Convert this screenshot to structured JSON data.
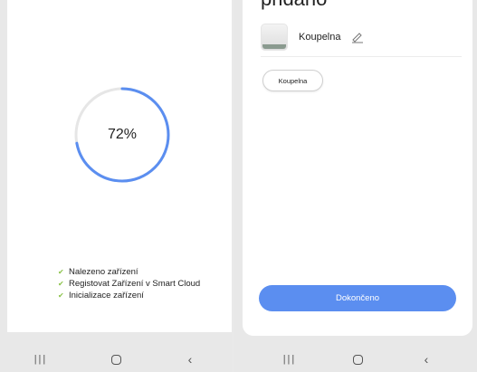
{
  "left": {
    "progress": {
      "value": 0.72,
      "label": "72%"
    },
    "checklist": [
      "Nalezeno zařízení",
      "Registovat Zařízení v Smart Cloud",
      "Inicializace zařízení"
    ],
    "colors": {
      "progress": "#5b8ef0",
      "track": "#e6e6e6",
      "check": "#8bc34a"
    }
  },
  "right": {
    "title": "přidáno",
    "device": {
      "name": "Koupelna",
      "icon": "device-image"
    },
    "room_chip": "Koupelna",
    "finish_label": "Dokončeno",
    "colors": {
      "button": "#5b8ef0"
    }
  },
  "nav": {
    "recent_icon": "recent-apps-icon",
    "home_icon": "home-icon",
    "back_icon": "back-icon"
  }
}
